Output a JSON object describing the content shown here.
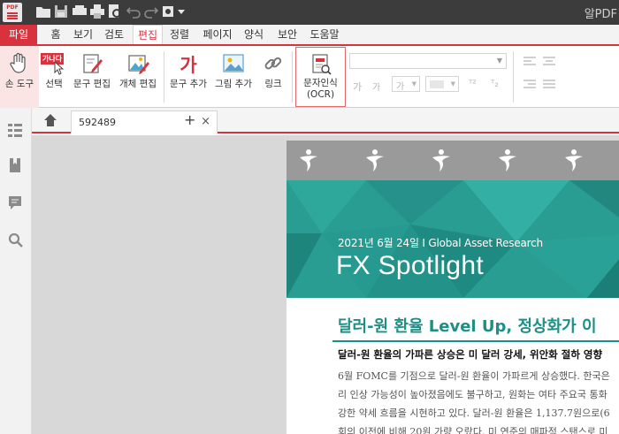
{
  "app": {
    "title": "알PDF",
    "logo_text": "PDF"
  },
  "menu": {
    "tabs": [
      "파일",
      "홈",
      "보기",
      "검토",
      "편집",
      "정렬",
      "페이지",
      "양식",
      "보안",
      "도움말"
    ],
    "active": "편집"
  },
  "ribbon": {
    "hand_tool": "손 도구",
    "select": "선택",
    "select_badge": "가나다",
    "text_edit": "문구 편집",
    "object_edit": "개체 편집",
    "add_text": "문구 추가",
    "add_text_glyph": "가",
    "add_image": "그림 추가",
    "link": "링크",
    "ocr_line1": "문자인식",
    "ocr_line2": "(OCR)",
    "font_size_glyph_a": "가",
    "font_size_glyph_b": "가",
    "font_color_glyph": "가"
  },
  "tabs": {
    "document_name": "592489",
    "close": "×",
    "add": "+"
  },
  "document": {
    "hero_date": "2021년 6월 24일 I Global Asset Research",
    "hero_title": "FX Spotlight",
    "heading": "달러-원 환율 Level Up, 정상화가 이",
    "subheading": "달러-원 환율의 가파른 상승은 미 달러 강세, 위안화 절하 영향",
    "para_line1": "6월 FOMC를 기점으로 달러-원 환율이 가파르게 상승했다. 한국은",
    "para_line2": "리 인상 가능성이 높아졌음에도 불구하고, 원화는 여타 주요국 통화",
    "para_line3": "강한 약세 흐름을 시현하고 있다. 달러-원 환율은 1,137.7원으로(6",
    "para_line4": "회의 이전에 비해 20원 가량 오랐다. 미 연준의 매파적 스탠스로 미"
  },
  "colors": {
    "accent": "#d9323f",
    "teal": "#2a9d93",
    "heading_teal": "#1c8f86"
  }
}
